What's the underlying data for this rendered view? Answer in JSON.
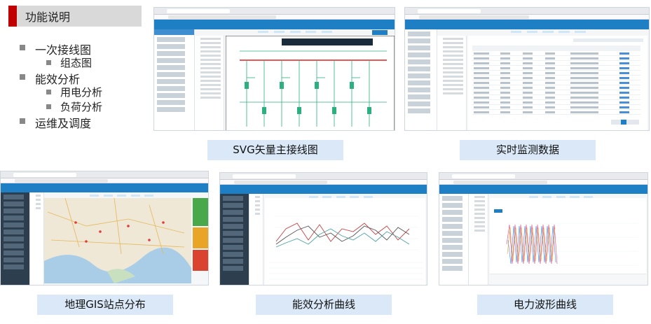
{
  "section": {
    "title": "功能说明"
  },
  "outline": {
    "items": [
      {
        "label": "一次接线图"
      },
      {
        "label": "组态图"
      },
      {
        "label": "能效分析"
      },
      {
        "label": "用电分析"
      },
      {
        "label": "负荷分析"
      },
      {
        "label": "运维及调度"
      }
    ]
  },
  "captions": {
    "svg": "SVG矢量主接线图",
    "realtime": "实时监测数据",
    "gis": "地理GIS站点分布",
    "energy": "能效分析曲线",
    "waveform": "电力波形曲线"
  },
  "colors": {
    "accent": "#c00000",
    "title_bg": "#d9d9d9",
    "caption_bg": "#dae8f7",
    "app_blue": "#1f7fc4"
  },
  "icons": {
    "bullet": "square-bullet"
  }
}
